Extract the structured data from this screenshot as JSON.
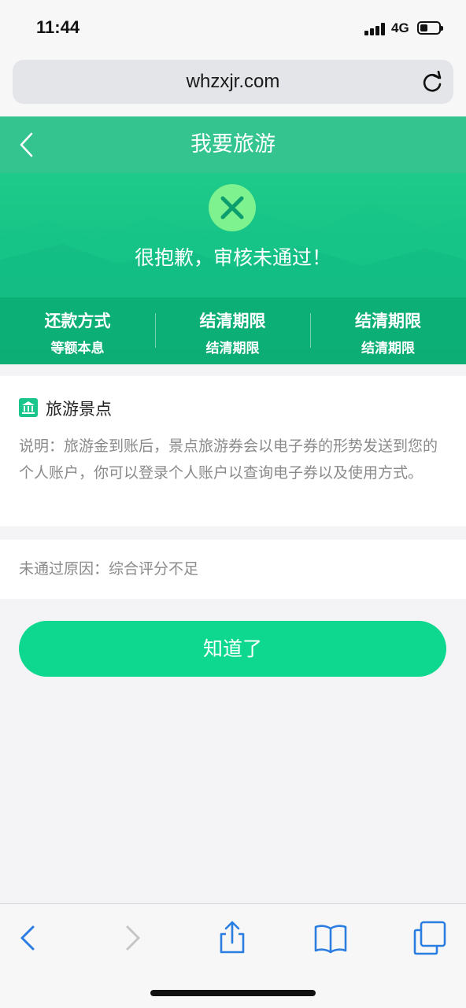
{
  "status": {
    "time": "11:44",
    "network": "4G"
  },
  "browser": {
    "url": "whzxjr.com"
  },
  "header": {
    "title": "我要旅游"
  },
  "result": {
    "message": "很抱歉，审核未通过！",
    "icon": "close-circle-icon"
  },
  "info": [
    {
      "label": "还款方式",
      "value": "等额本息"
    },
    {
      "label": "结清期限",
      "value": "结清期限"
    },
    {
      "label": "结清期限",
      "value": "结清期限"
    }
  ],
  "attraction": {
    "title": "旅游景点",
    "description": "说明：旅游金到账后，景点旅游券会以电子券的形势发送到您的个人账户，你可以登录个人账户以查询电子券以及使用方式。"
  },
  "reason": {
    "text": "未通过原因：综合评分不足"
  },
  "actions": {
    "ok_label": "知道了"
  },
  "colors": {
    "header": "#33c490",
    "banner": "#13be84",
    "button": "#0ed88f",
    "link_blue": "#2a7de1"
  }
}
